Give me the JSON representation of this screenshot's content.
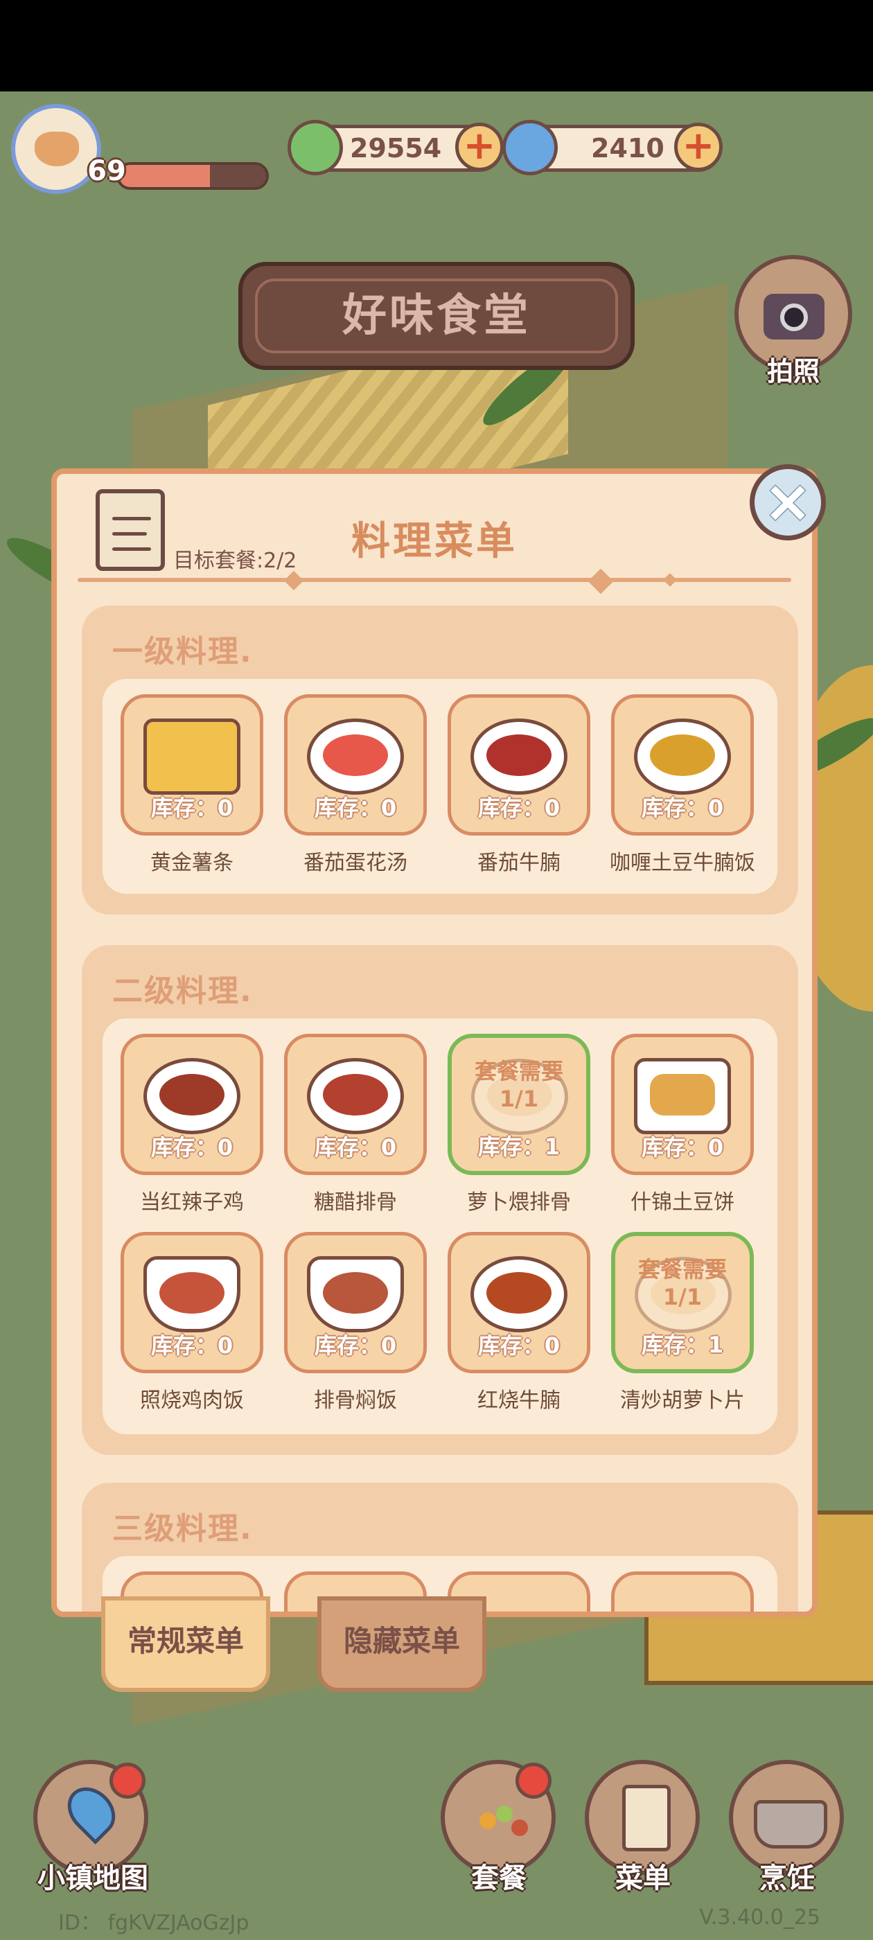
{
  "header": {
    "level": "69",
    "level_progress": 0.62,
    "currency_green": {
      "value": "29554",
      "icon": "clover-coin-icon"
    },
    "currency_blue": {
      "value": "2410",
      "icon": "swirl-gem-icon"
    }
  },
  "sign": {
    "title": "好味食堂"
  },
  "camera": {
    "label": "拍照"
  },
  "panel": {
    "title": "料理菜单",
    "target": "目标套餐:2/2",
    "sections": [
      {
        "title": "一级料理.",
        "items": [
          {
            "name": "黄金薯条",
            "stock": "库存：0",
            "color": "#f1c04d"
          },
          {
            "name": "番茄蛋花汤",
            "stock": "库存：0",
            "color": "#e8584a"
          },
          {
            "name": "番茄牛腩",
            "stock": "库存：0",
            "color": "#b1322c"
          },
          {
            "name": "咖喱土豆牛腩饭",
            "stock": "库存：0",
            "color": "#d9a12c"
          }
        ]
      },
      {
        "title": "二级料理.",
        "items": [
          {
            "name": "当红辣子鸡",
            "stock": "库存：0",
            "color": "#9e3a28"
          },
          {
            "name": "糖醋排骨",
            "stock": "库存：0",
            "color": "#b4402f"
          },
          {
            "name": "萝卜煨排骨",
            "stock": "库存：1",
            "requirement": "套餐需要 1/1",
            "color": "#f3dcc0"
          },
          {
            "name": "什锦土豆饼",
            "stock": "库存：0",
            "color": "#e3a84b"
          },
          {
            "name": "照烧鸡肉饭",
            "stock": "库存：0",
            "color": "#c6543b"
          },
          {
            "name": "排骨焖饭",
            "stock": "库存：0",
            "color": "#b8573c"
          },
          {
            "name": "红烧牛腩",
            "stock": "库存：0",
            "color": "#b54a22"
          },
          {
            "name": "清炒胡萝卜片",
            "stock": "库存：1",
            "requirement": "套餐需要 1/1",
            "color": "#f3dcc0"
          }
        ]
      },
      {
        "title": "三级料理."
      }
    ]
  },
  "tabs": {
    "regular": "常规菜单",
    "hidden": "隐藏菜单"
  },
  "nav": {
    "map": "小镇地图",
    "combo": "套餐",
    "menu": "菜单",
    "cook": "烹饪"
  },
  "footer": {
    "id": "ID： fgKVZJAoGzJp",
    "version": "V.3.40.0_25"
  }
}
